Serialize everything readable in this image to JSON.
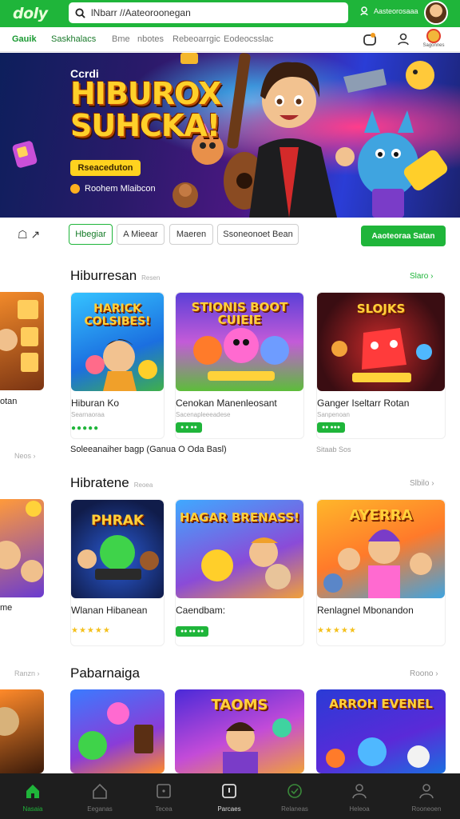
{
  "header": {
    "logo": "doly",
    "search_value": "lNbarr //Aateoroonegan",
    "account_label": "Aasteorosaaa"
  },
  "nav": {
    "items": [
      "Gauik",
      "Saskhalacs",
      "Bme",
      "nbotes",
      "Rebeoarrgic",
      "Eodeocsslac"
    ],
    "user_label": "Sagonnes"
  },
  "banner": {
    "subtitle": "Ccrdi",
    "title_line1": "HIBUROX",
    "title_line2": "SUHCKA!",
    "button_label": "Rseaceduton",
    "tag_label": "Roohem Mlaibcon"
  },
  "filters": {
    "icon_label": "☖ ↗",
    "pills": [
      "Hbegiar",
      "A Mieear",
      "Maeren",
      "Ssoneonoet Bean"
    ],
    "active_index": 0,
    "cta_label": "Aaoteoraa Satan"
  },
  "sections": [
    {
      "title": "Hiburresan",
      "hint": "Resen",
      "link": "Slaro ›",
      "partial_label": "otan",
      "cards": [
        {
          "name": "Hiburan Ko",
          "sub": "Searnaoraa",
          "rating": "●●●●●",
          "thumb_title": "HARICK COLSIBES!"
        },
        {
          "name": "Cenokan Manenleosant",
          "sub": "Sacenapleeeadese",
          "tag": "● ●  ●●",
          "thumb_title": "STIONIS BOOT CUIEIE"
        },
        {
          "name": "Ganger Iseltarr Rotan",
          "sub": "Sanpenoan",
          "tag": "●● ●●●",
          "thumb_title": "SLOJKS"
        }
      ]
    },
    {
      "title": "Hibratene",
      "hint": "Reoea",
      "link": "Slbilo ›",
      "partial_label": "me",
      "cards": [
        {
          "name": "Wlanan Hibanean",
          "sub": "",
          "rating": "★★★★★",
          "thumb_title": "PHRAK"
        },
        {
          "name": "Caendbam:",
          "sub": "",
          "tag": "●● ●● ●●",
          "thumb_title": "HAGAR BRENASS!"
        },
        {
          "name": "Renlagnel Mbonandon",
          "sub": "",
          "rating": "★★★★★",
          "thumb_title": "AYERRA"
        }
      ]
    },
    {
      "title": "Pabarnaiga",
      "hint": "",
      "link": "Roono ›",
      "partial_label": "",
      "cards": [
        {
          "name": "",
          "sub": "",
          "thumb_title": ""
        },
        {
          "name": "",
          "sub": "",
          "thumb_title": "TAOMS"
        },
        {
          "name": "",
          "sub": "",
          "thumb_title": "ARROH EVENEL"
        }
      ]
    }
  ],
  "promo": {
    "line": "Soleeanaiher bagp (Ganua O Oda Basl)",
    "right": "Sitaab Sos",
    "section1_side": "Neos ›",
    "section3_side": "Ranzn ›"
  },
  "tabbar": {
    "tabs": [
      "Nasaia",
      "Eeganas",
      "Tecea",
      "Parcaes",
      "Relaneas",
      "Heleoa",
      "Rooneoen"
    ],
    "active_index": 0,
    "current_index": 3
  },
  "colors": {
    "brand_green": "#1fb53a",
    "banner_title": "#ffd02a",
    "tabbar_bg": "#1e1e1e"
  }
}
